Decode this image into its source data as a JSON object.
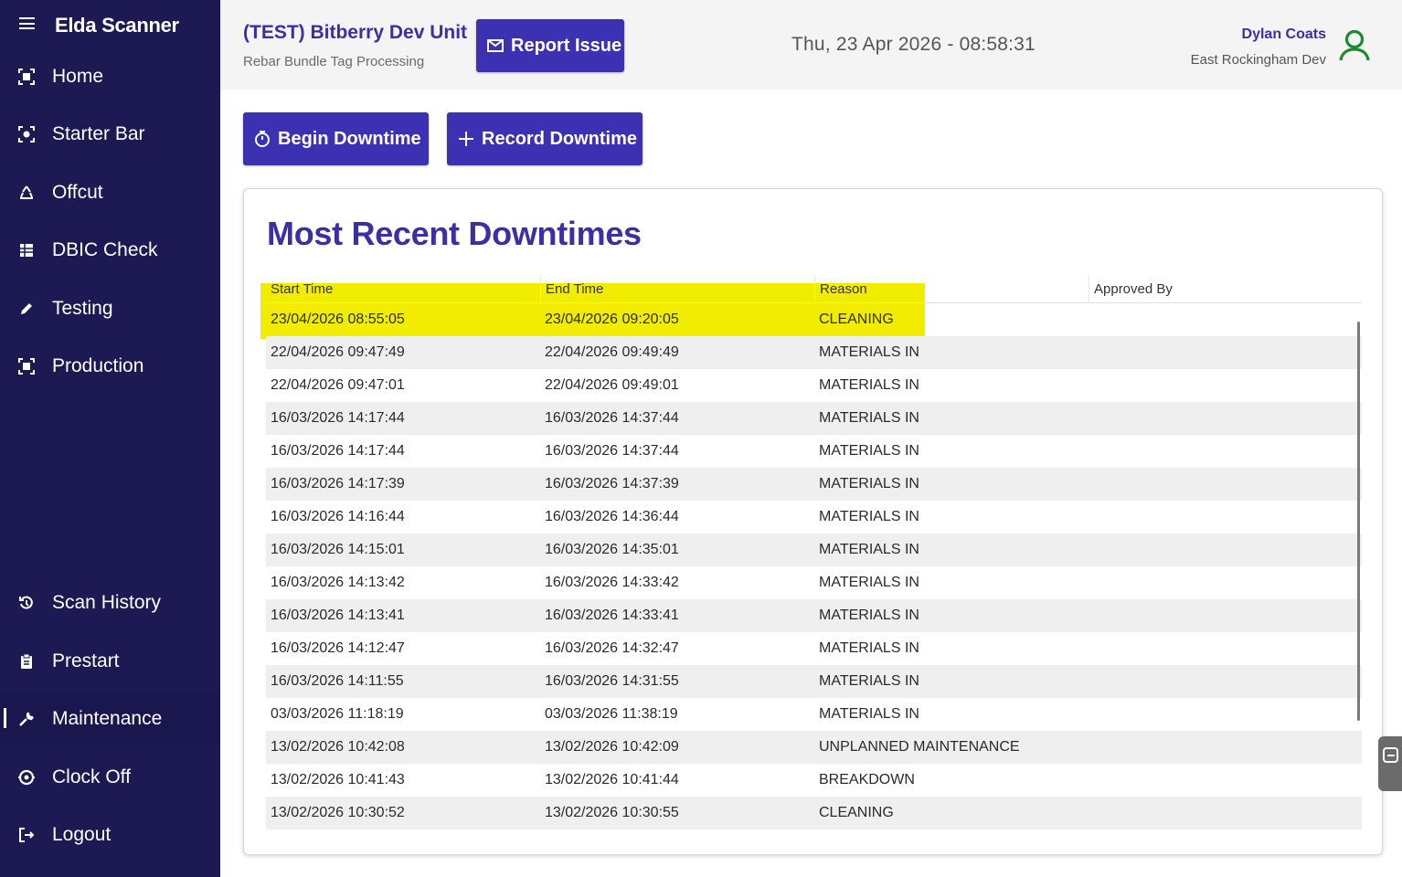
{
  "app": {
    "title": "Elda Scanner"
  },
  "sidebar": {
    "items": [
      {
        "label": "Home",
        "icon": "scan-icon"
      },
      {
        "label": "Starter Bar",
        "icon": "scan-target-icon"
      },
      {
        "label": "Offcut",
        "icon": "recycle-icon"
      },
      {
        "label": "DBIC Check",
        "icon": "grid-icon"
      },
      {
        "label": "Testing",
        "icon": "pencil-icon"
      },
      {
        "label": "Production",
        "icon": "scan-icon"
      },
      {
        "label": "Scan History",
        "icon": "history-icon"
      },
      {
        "label": "Prestart",
        "icon": "clipboard-icon"
      },
      {
        "label": "Maintenance",
        "icon": "wrench-icon",
        "active": true
      },
      {
        "label": "Clock Off",
        "icon": "clock-off-icon"
      },
      {
        "label": "Logout",
        "icon": "logout-icon"
      }
    ]
  },
  "header": {
    "unit_title": "(TEST) Bitberry Dev Unit",
    "unit_subtitle": "Rebar Bundle Tag Processing",
    "report_label": "Report Issue",
    "datetime": "Thu, 23 Apr 2026 - 08:58:31",
    "user_name": "Dylan Coats",
    "user_site": "East Rockingham Dev"
  },
  "actions": {
    "begin_label": "Begin Downtime",
    "record_label": "Record Downtime"
  },
  "downtimes": {
    "title": "Most Recent Downtimes",
    "columns": [
      "Start Time",
      "End Time",
      "Reason",
      "Approved By"
    ],
    "rows": [
      [
        "23/04/2026 08:55:05",
        "23/04/2026 09:20:05",
        "CLEANING",
        ""
      ],
      [
        "22/04/2026 09:47:49",
        "22/04/2026 09:49:49",
        "MATERIALS IN",
        ""
      ],
      [
        "22/04/2026 09:47:01",
        "22/04/2026 09:49:01",
        "MATERIALS IN",
        ""
      ],
      [
        "16/03/2026 14:17:44",
        "16/03/2026 14:37:44",
        "MATERIALS IN",
        ""
      ],
      [
        "16/03/2026 14:17:44",
        "16/03/2026 14:37:44",
        "MATERIALS IN",
        ""
      ],
      [
        "16/03/2026 14:17:39",
        "16/03/2026 14:37:39",
        "MATERIALS IN",
        ""
      ],
      [
        "16/03/2026 14:16:44",
        "16/03/2026 14:36:44",
        "MATERIALS IN",
        ""
      ],
      [
        "16/03/2026 14:15:01",
        "16/03/2026 14:35:01",
        "MATERIALS IN",
        ""
      ],
      [
        "16/03/2026 14:13:42",
        "16/03/2026 14:33:42",
        "MATERIALS IN",
        ""
      ],
      [
        "16/03/2026 14:13:41",
        "16/03/2026 14:33:41",
        "MATERIALS IN",
        ""
      ],
      [
        "16/03/2026 14:12:47",
        "16/03/2026 14:32:47",
        "MATERIALS IN",
        ""
      ],
      [
        "16/03/2026 14:11:55",
        "16/03/2026 14:31:55",
        "MATERIALS IN",
        ""
      ],
      [
        "03/03/2026 11:18:19",
        "03/03/2026 11:38:19",
        "MATERIALS IN",
        ""
      ],
      [
        "13/02/2026 10:42:08",
        "13/02/2026 10:42:09",
        "UNPLANNED MAINTENANCE",
        ""
      ],
      [
        "13/02/2026 10:41:43",
        "13/02/2026 10:41:44",
        "BREAKDOWN",
        ""
      ],
      [
        "13/02/2026 10:30:52",
        "13/02/2026 10:30:55",
        "CLEANING",
        ""
      ]
    ]
  },
  "colors": {
    "sidebar_bg": "#1c1953",
    "brand_purple": "#3d31b3",
    "title_purple": "#3b2fa6",
    "highlight_yellow": "#f2ec00",
    "user_icon_green": "#1e8a2e"
  }
}
